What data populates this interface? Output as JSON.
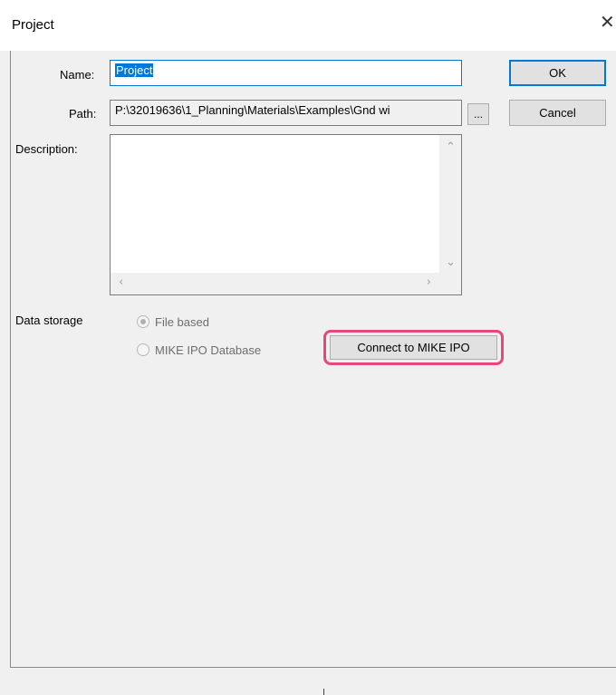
{
  "window": {
    "title": "Project",
    "close_glyph": "✕"
  },
  "form": {
    "name_label": "Name:",
    "name_value": "Project",
    "path_label": "Path:",
    "path_value": "P:\\32019636\\1_Planning\\Materials\\Examples\\Gnd wi",
    "browse_label": "...",
    "description_label": "Description:",
    "description_value": ""
  },
  "buttons": {
    "ok_label": "OK",
    "cancel_label": "Cancel",
    "connect_label": "Connect to  MIKE IPO"
  },
  "data_storage": {
    "label": "Data storage",
    "options": [
      {
        "label": "File based",
        "selected": true
      },
      {
        "label": "MIKE IPO Database",
        "selected": false
      }
    ]
  },
  "colors": {
    "accent": "#0078d7",
    "highlight": "#e8467c"
  }
}
